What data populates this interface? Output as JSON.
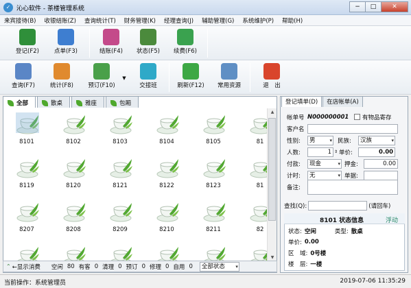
{
  "window": {
    "title": "沁心软件 - 茶楼管理系统",
    "app_icon": "leaf-logo-icon",
    "minimize": "−",
    "maximize": "□",
    "close": "✕"
  },
  "menu": [
    "来宾接待(B)",
    "收银结账(Z)",
    "查询统计(T)",
    "财务管理(K)",
    "经理查询(J)",
    "辅助管理(G)",
    "系统维护(P)",
    "帮助(H)"
  ],
  "toolbar1": [
    {
      "label": "登记(F2)",
      "icon": "register-icon",
      "color": "#2f8f3a"
    },
    {
      "label": "点单(F3)",
      "icon": "order-icon",
      "color": "#3e7ed0"
    },
    {
      "label": "结账(F4)",
      "icon": "checkout-icon",
      "color": "#c44a8a"
    },
    {
      "label": "状态(F5)",
      "icon": "status-icon",
      "color": "#4b8a3c"
    },
    {
      "label": "续费(F6)",
      "icon": "renew-icon",
      "color": "#3aa24f"
    }
  ],
  "toolbar2": [
    {
      "label": "查询(F7)",
      "icon": "search-icon",
      "color": "#5a86c6"
    },
    {
      "label": "统计(F8)",
      "icon": "stats-icon",
      "color": "#e08a2e"
    },
    {
      "label": "预订(F10)",
      "icon": "booking-icon",
      "color": "#4aa04a"
    },
    {
      "label": "交接班",
      "icon": "shift-change-icon",
      "color": "#2fa9c8"
    },
    {
      "label": "刷新(F12)",
      "icon": "refresh-icon",
      "color": "#3da844"
    },
    {
      "label": "常用资源",
      "icon": "resources-icon",
      "color": "#5f8fc4"
    },
    {
      "label": "退　出",
      "icon": "exit-icon",
      "color": "#d9452c"
    }
  ],
  "tabs": [
    "全部",
    "散桌",
    "雅座",
    "包厢"
  ],
  "rooms": [
    "8101",
    "8102",
    "8103",
    "8104",
    "8105",
    "81",
    "8119",
    "8120",
    "8121",
    "8122",
    "8123",
    "81",
    "8207",
    "8208",
    "8209",
    "8210",
    "8211",
    "82",
    "",
    "",
    "",
    "",
    "",
    ""
  ],
  "status": {
    "show_consume": "←显示消费",
    "idle_label": "空闲",
    "idle": "80",
    "occupied_label": "有客",
    "occupied": "0",
    "cleaning_label": "清理",
    "cleaning": "0",
    "reserved_label": "预订",
    "reserved": "0",
    "repair_label": "修理",
    "repair": "0",
    "self_label": "自用",
    "self": "0",
    "filter": "全部状态"
  },
  "bottom": {
    "operator": "当前操作：系统管理员",
    "datetime": "2019-07-06 11:35:29"
  },
  "right_tabs": [
    "登记填单(D)",
    "在店帐单(A)"
  ],
  "form": {
    "bill_label": "帐单号",
    "bill": "N000000001",
    "deposit_label": "有物品寄存",
    "guest_label": "客户名",
    "guest": "",
    "gender_label": "性别:",
    "gender": "男",
    "ethnic_label": "民族:",
    "ethnic": "汉族",
    "count_label": "人数:",
    "count": "1",
    "price_label": "单价:",
    "price": "0.00",
    "pay_label": "付款:",
    "pay": "现金",
    "deposit2_label": "押金:",
    "deposit2": "0.00",
    "timing_label": "计时:",
    "timing": "无",
    "note2_label": "单据:",
    "note2": "",
    "remark_label": "备注:",
    "remark": ""
  },
  "search": {
    "label": "查找(Q):",
    "hint": "(请回车)"
  },
  "info": {
    "title": "8101 状态信息",
    "float": "浮动",
    "state_label": "状态:",
    "state": "空闲",
    "type_label": "类型:",
    "type": "散桌",
    "price_label": "单价:",
    "price": "0.00",
    "area_label": "区　域:",
    "area": "0号楼",
    "floor_label": "楼　层:",
    "floor": "一楼"
  }
}
